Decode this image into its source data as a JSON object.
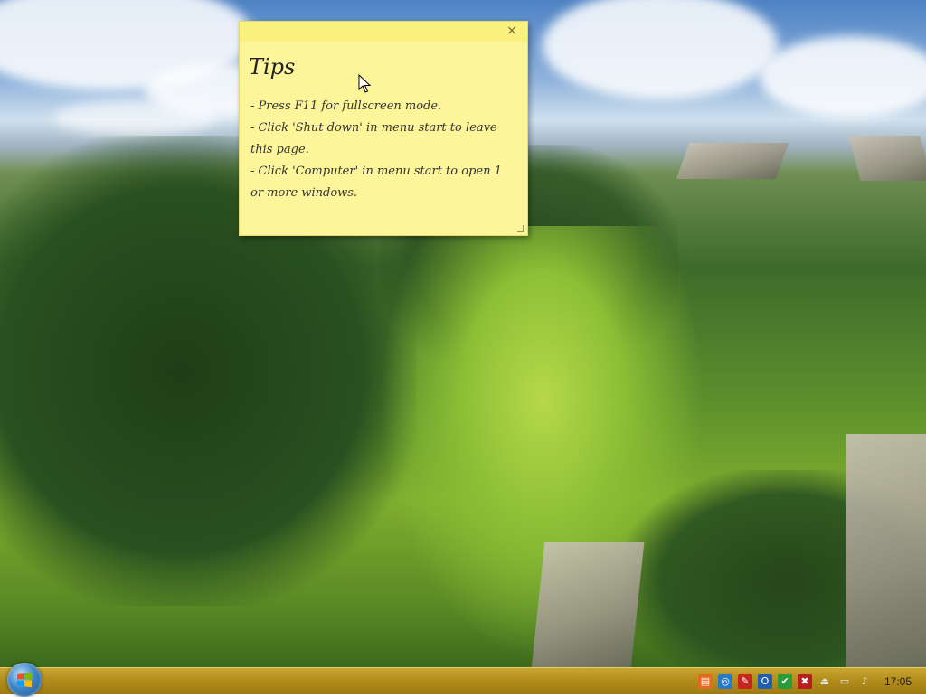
{
  "sticky_note": {
    "title": "Tips",
    "close_label": "×",
    "lines": [
      "- Press F11 for fullscreen mode.",
      "- Click 'Shut down' in menu start to leave this page.",
      "- Click 'Computer' in menu start to open 1 or more windows."
    ],
    "background_color": "#fdf59a"
  },
  "taskbar": {
    "color": "#b38e1c",
    "start_button_icon": "windows-logo-icon",
    "clock": "17:05",
    "tray_icons": [
      {
        "name": "app-orange-icon",
        "glyph": "▤",
        "color": "#e36b1f"
      },
      {
        "name": "network-globe-icon",
        "glyph": "◎",
        "color": "#2b79c2"
      },
      {
        "name": "pdf-icon",
        "glyph": "✎",
        "color": "#c8251f"
      },
      {
        "name": "outlook-icon",
        "glyph": "O",
        "color": "#1f5fb0"
      },
      {
        "name": "security-check-icon",
        "glyph": "✔",
        "color": "#2a9a3a"
      },
      {
        "name": "flag-error-icon",
        "glyph": "✖",
        "color": "#b81e1e"
      },
      {
        "name": "usb-device-icon",
        "glyph": "⏏",
        "color": "#e8e8e8"
      },
      {
        "name": "action-center-icon",
        "glyph": "▭",
        "color": "#e8e8e8"
      },
      {
        "name": "volume-icon",
        "glyph": "♪",
        "color": "#e8e8e8"
      }
    ]
  }
}
